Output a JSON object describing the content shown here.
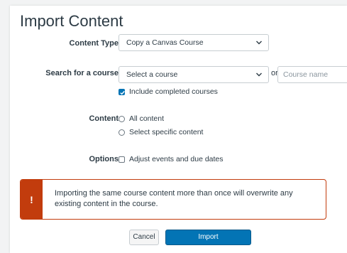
{
  "page": {
    "title": "Import Content"
  },
  "form": {
    "content_type": {
      "label": "Content Type",
      "selected": "Copy a Canvas Course"
    },
    "search_course": {
      "label": "Search for a course",
      "selected": "Select a course",
      "or_text": "or",
      "course_name_placeholder": "Course name",
      "include_completed_label": "Include completed courses",
      "include_completed_checked": true
    },
    "content": {
      "label": "Content",
      "options": [
        "All content",
        "Select specific content"
      ]
    },
    "options": {
      "label": "Options",
      "adjust_dates_label": "Adjust events and due dates",
      "adjust_dates_checked": false
    }
  },
  "alert": {
    "icon": "!",
    "text": "Importing the same course content more than once will overwrite any existing content in the course."
  },
  "buttons": {
    "cancel_label": "Cancel",
    "import_label": "Import"
  },
  "colors": {
    "primary": "#0374b5",
    "danger": "#c23c0d",
    "text": "#2d3b45"
  }
}
